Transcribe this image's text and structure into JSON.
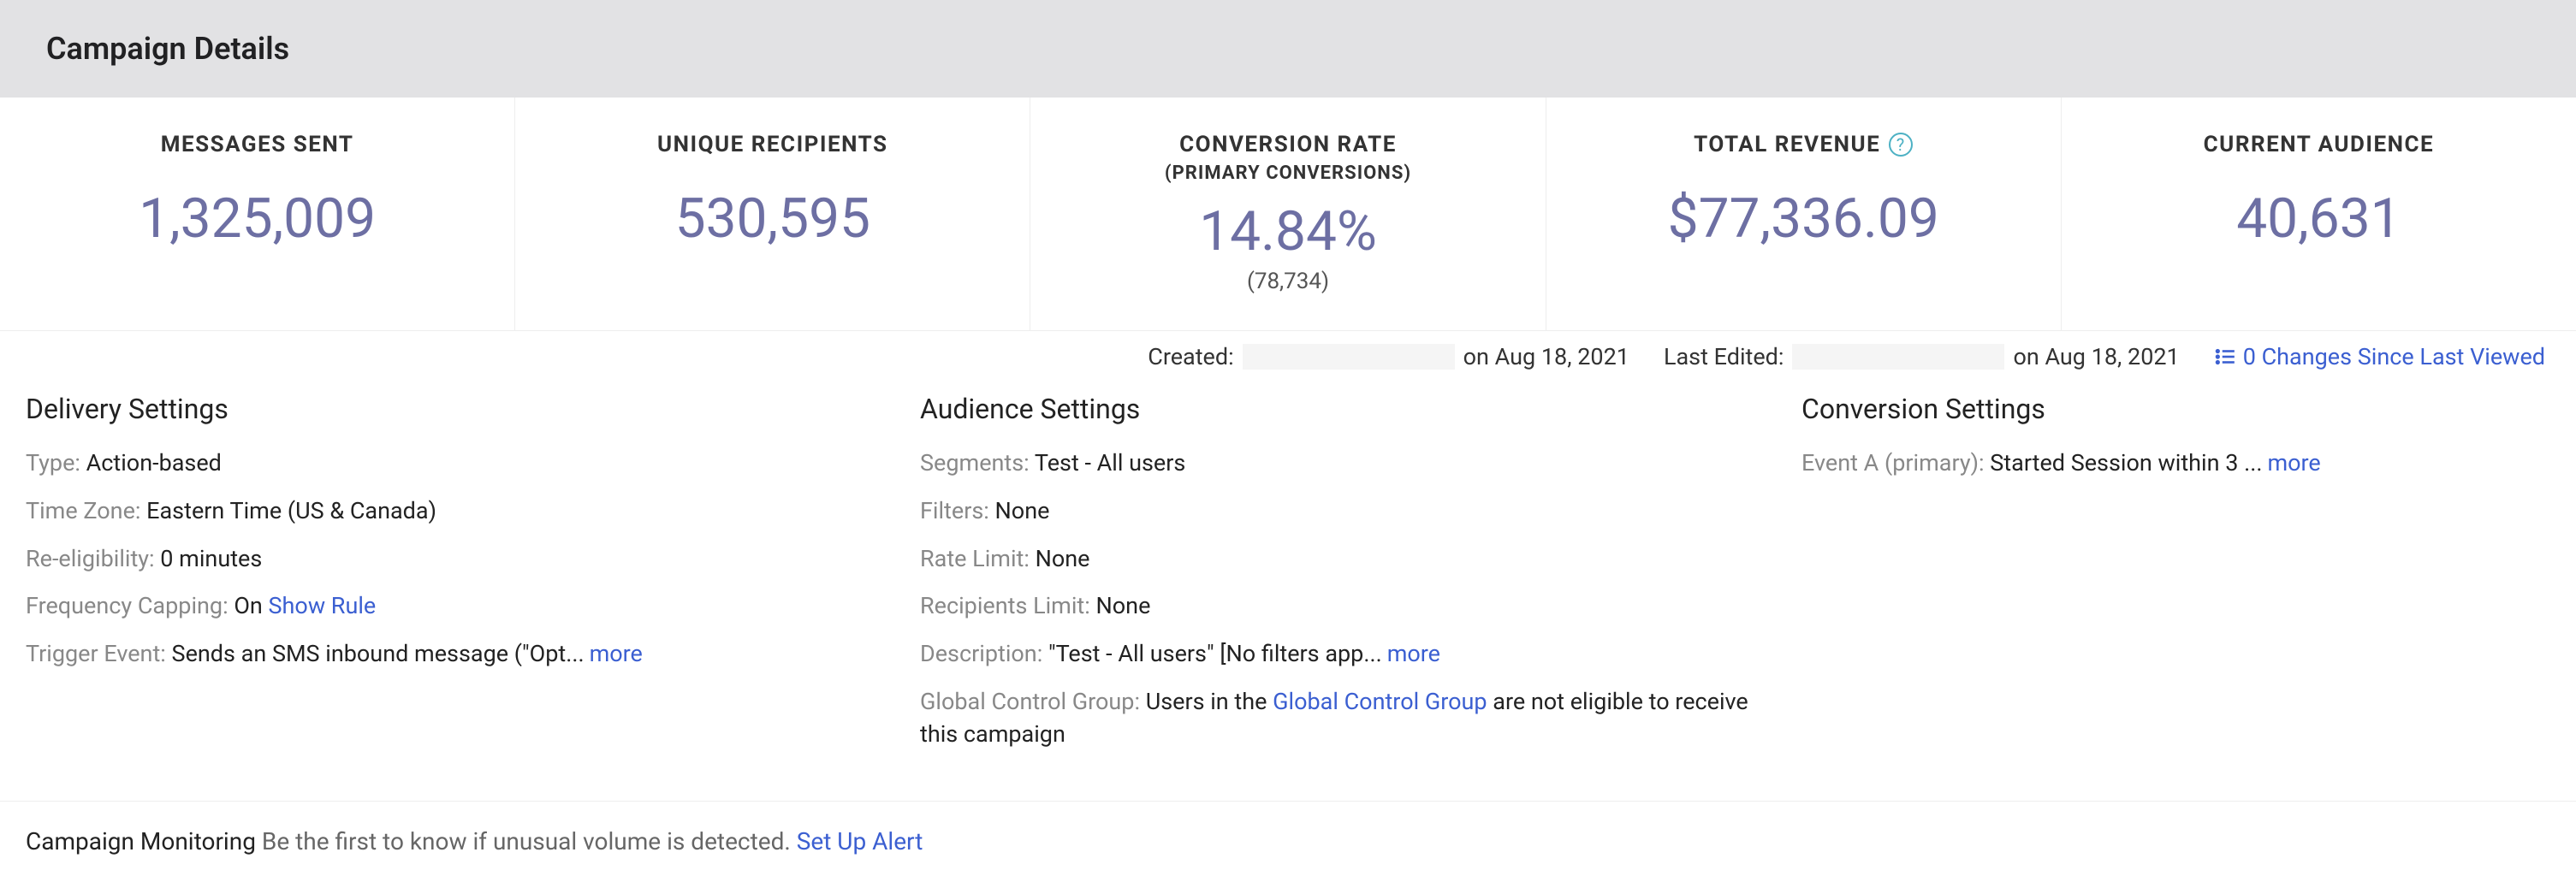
{
  "header": {
    "title": "Campaign Details"
  },
  "stats": [
    {
      "label": "MESSAGES SENT",
      "value": "1,325,009"
    },
    {
      "label": "UNIQUE RECIPIENTS",
      "value": "530,595"
    },
    {
      "label": "CONVERSION RATE",
      "sublabel": "(PRIMARY CONVERSIONS)",
      "value": "14.84%",
      "subvalue": "(78,734)"
    },
    {
      "label": "TOTAL REVENUE",
      "help": true,
      "value": "$77,336.09"
    },
    {
      "label": "CURRENT AUDIENCE",
      "value": "40,631"
    }
  ],
  "meta": {
    "created_label": "Created:",
    "created_date": "on Aug 18, 2021",
    "edited_label": "Last Edited:",
    "edited_date": "on Aug 18, 2021",
    "changes_link": "0 Changes Since Last Viewed"
  },
  "delivery": {
    "heading": "Delivery Settings",
    "type_key": "Type: ",
    "type_val": "Action-based",
    "tz_key": "Time Zone: ",
    "tz_val": "Eastern Time (US & Canada)",
    "reelig_key": "Re-eligibility: ",
    "reelig_val": "0 minutes",
    "freq_key": "Frequency Capping: ",
    "freq_val": "On ",
    "freq_link": "Show Rule",
    "trigger_key": "Trigger Event: ",
    "trigger_val": "Sends an SMS inbound message (\"Opt...",
    "more": "more"
  },
  "audience": {
    "heading": "Audience Settings",
    "seg_key": "Segments: ",
    "seg_val": "Test - All users",
    "filters_key": "Filters: ",
    "filters_val": "None",
    "rate_key": "Rate Limit: ",
    "rate_val": "None",
    "recip_key": "Recipients Limit: ",
    "recip_val": "None",
    "desc_key": "Description: ",
    "desc_val": "\"Test - All users\" [No filters app...",
    "more": "more",
    "gcg_key": "Global Control Group: ",
    "gcg_pre": "Users in the ",
    "gcg_link": "Global Control Group",
    "gcg_post": " are not eligible to receive this campaign"
  },
  "conversion": {
    "heading": "Conversion Settings",
    "event_key": "Event A (primary): ",
    "event_val": "Started Session within 3 ...",
    "more": "more"
  },
  "monitoring": {
    "title": "Campaign Monitoring ",
    "text": "Be the first to know if unusual volume is detected. ",
    "link": "Set Up Alert"
  }
}
